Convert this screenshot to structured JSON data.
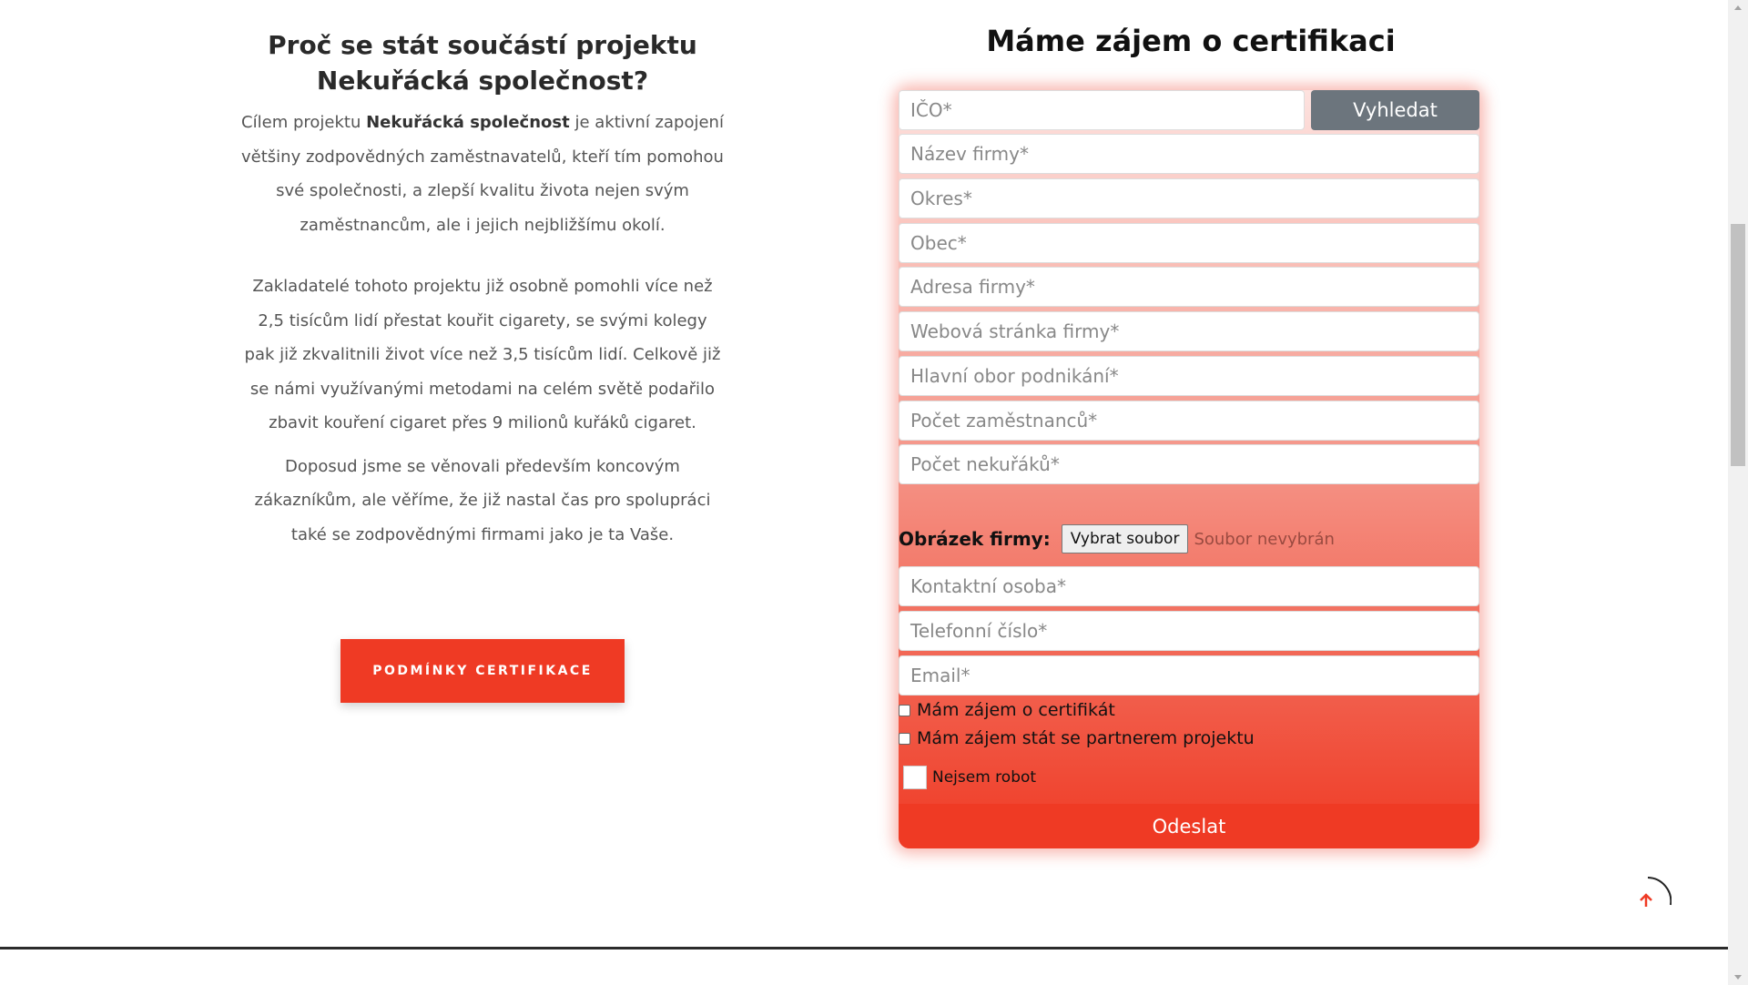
{
  "left": {
    "heading_line1": "Proč se stát součástí projektu",
    "heading_line2": "Nekuřácká společnost?",
    "para1_before": "Cílem projektu ",
    "para1_bold": "Nekuřácká společnost",
    "para1_after": " je aktivní zapojení většiny zodpovědných zaměstnavatelů, kteří tím pomohou své společnosti, a zlepší kvalitu života nejen svým zaměstnancům, ale i jejich nejbližšímu okolí.",
    "para2": "Zakladatelé tohoto projektu již osobně pomohli více než 2,5 tisícům lidí přestat kouřit cigarety, se svými kolegy pak již zkvalitnili život více než 3,5 tisícům lidí. Celkově již se námi využívanými metodami na celém světě podařilo zbavit kouření cigaret přes 9 milionů kuřáků cigaret.",
    "para3": "Doposud jsme se věnovali především koncovým zákazníkům, ale věříme, že již nastal čas pro spolupráci také se zodpovědnými firmami jako je ta Vaše.",
    "button": "PODMÍNKY CERTIFIKACE"
  },
  "form": {
    "title": "Máme zájem o certifikaci",
    "ico_placeholder": "IČO*",
    "search_button": "Vyhledat",
    "fields": [
      "Název firmy*",
      "Okres*",
      "Obec*",
      "Adresa firmy*",
      "Webová stránka firmy*",
      "Hlavní obor podnikání*",
      "Počet zaměstnanců*",
      "Počet nekuřáků*"
    ],
    "file_label": "Obrázek firmy:",
    "file_button": "Vybrat soubor",
    "file_status": "Soubor nevybrán",
    "fields2": [
      "Kontaktní osoba*",
      "Telefonní číslo*",
      "Email*"
    ],
    "checkbox1": "Mám zájem o certifikát",
    "checkbox2": "Mám zájem stát se partnerem projektu",
    "robot": "Nejsem robot",
    "submit": "Odeslat"
  },
  "colors": {
    "accent": "#ef3a24",
    "search_button": "#6c757d"
  },
  "icons": {
    "back_to_top": "arrow-up-icon"
  }
}
